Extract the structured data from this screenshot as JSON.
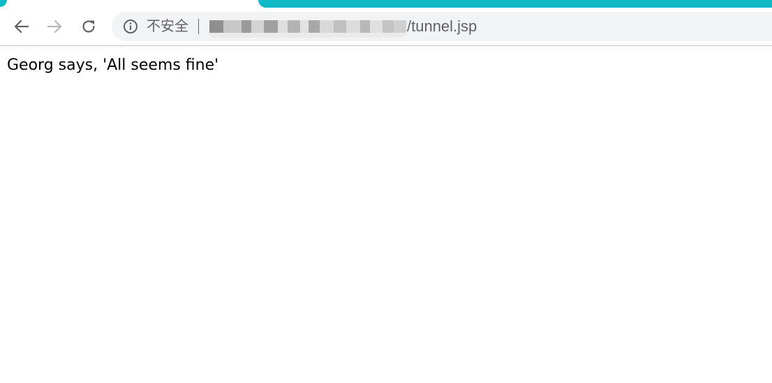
{
  "browser": {
    "accent_color": "#10b9c6",
    "toolbar": {
      "back_icon": "arrow-left-icon",
      "forward_icon": "arrow-right-icon",
      "reload_icon": "reload-icon"
    },
    "omnibox": {
      "info_icon": "info-icon",
      "security_label": "不安全",
      "url_path": "/tunnel.jsp"
    }
  },
  "page": {
    "message": "Georg says, 'All seems fine'"
  }
}
